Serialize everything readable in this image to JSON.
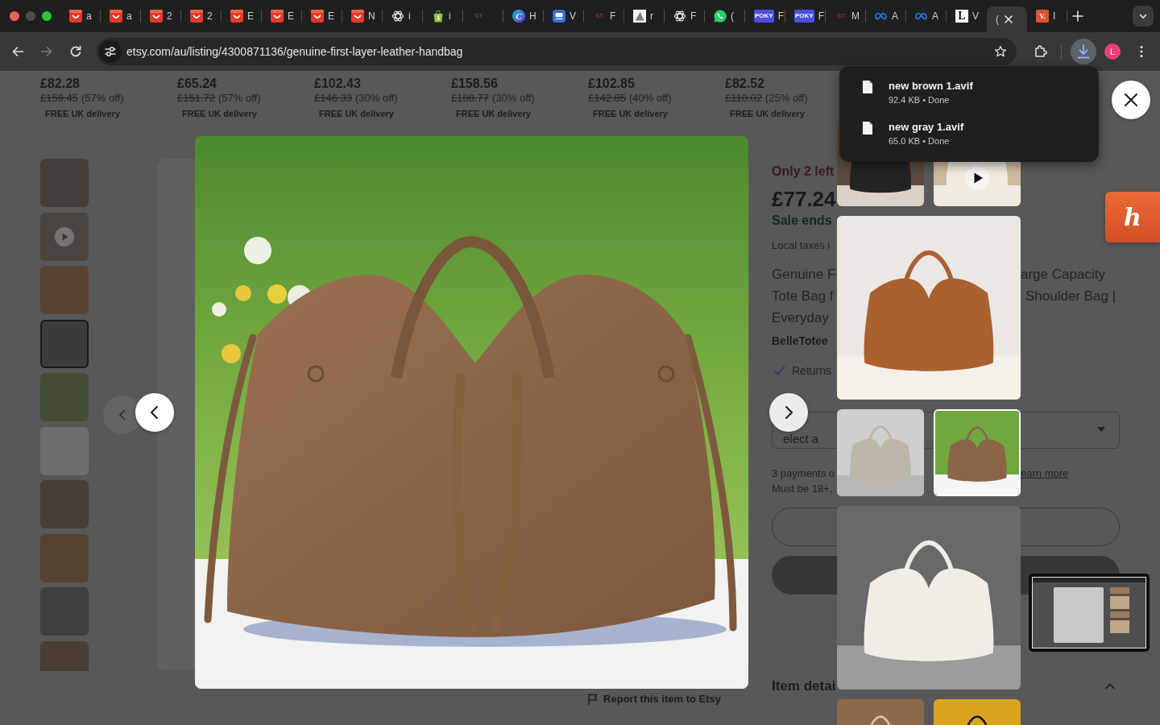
{
  "tabs": [
    {
      "kind": "smile",
      "title": "a",
      "selected": false
    },
    {
      "kind": "smile",
      "title": "a",
      "selected": false
    },
    {
      "kind": "smile",
      "title": "2",
      "selected": false
    },
    {
      "kind": "smile",
      "title": "2",
      "selected": false
    },
    {
      "kind": "smile",
      "title": "E",
      "selected": false
    },
    {
      "kind": "smile",
      "title": "E",
      "selected": false
    },
    {
      "kind": "smile",
      "title": "E",
      "selected": false
    },
    {
      "kind": "smile",
      "title": "N",
      "selected": false
    },
    {
      "kind": "knot",
      "title": "i",
      "selected": false
    },
    {
      "kind": "bag",
      "title": "i",
      "selected": false
    },
    {
      "kind": "wordmark",
      "logo": "ST",
      "selected": false
    },
    {
      "kind": "monogram",
      "logo": "C",
      "title": "H",
      "selected": false
    },
    {
      "kind": "app",
      "title": "V",
      "selected": false
    },
    {
      "kind": "wordmark",
      "logo": "ST",
      "title": "F",
      "selected": false
    },
    {
      "kind": "shark",
      "title": "r",
      "selected": false
    },
    {
      "kind": "knot",
      "title": "F",
      "selected": false
    },
    {
      "kind": "chat",
      "title": "(",
      "selected": false
    },
    {
      "kind": "badge",
      "logo": "POKY",
      "color": "#4b4ee3",
      "title": "F",
      "selected": false
    },
    {
      "kind": "badge",
      "logo": "POKY",
      "color": "#4b4ee3",
      "title": "F",
      "selected": false
    },
    {
      "kind": "wordmark",
      "logo": "ST",
      "title": "M",
      "selected": false
    },
    {
      "kind": "infinity",
      "title": "A",
      "selected": false
    },
    {
      "kind": "infinity",
      "title": "A",
      "selected": false
    },
    {
      "kind": "tile",
      "logo": "L",
      "title": "V",
      "selected": false
    },
    {
      "title": "(",
      "selected": true
    },
    {
      "kind": "badge",
      "logo": "V.",
      "color": "#e2502e",
      "title": "I",
      "selected": false
    }
  ],
  "toolbar": {
    "back_disabled": false,
    "forward_disabled": true,
    "url": "etsy.com/au/listing/4300871136/genuine-first-layer-leather-handbag",
    "downloads_active": true,
    "profile_initial": "L"
  },
  "page": {
    "price_cards": [
      {
        "price": "£82.28",
        "original_price": "£159.45",
        "discount": "(57% off)",
        "delivery": "FREE UK delivery"
      },
      {
        "price": "£65.24",
        "original_price": "£151.72",
        "discount": "(57% off)",
        "delivery": "FREE UK delivery"
      },
      {
        "price": "£102.43",
        "original_price": "£146.33",
        "discount": "(30% off)",
        "delivery": "FREE UK delivery"
      },
      {
        "price": "£158.56",
        "original_price": "£188.77",
        "discount": "(30% off)",
        "delivery": "FREE UK delivery"
      },
      {
        "price": "£102.85",
        "original_price": "£142.85",
        "discount": "(40% off)",
        "delivery": "FREE UK delivery"
      },
      {
        "price": "£82.52",
        "original_price": "£110.02",
        "discount": "(25% off)",
        "delivery": "FREE UK delivery"
      }
    ],
    "gallery": [
      {
        "video": false,
        "selected": false
      },
      {
        "video": true,
        "selected": false
      },
      {
        "video": false,
        "selected": false
      },
      {
        "video": false,
        "selected": true
      },
      {
        "video": false,
        "selected": false
      },
      {
        "video": false,
        "selected": false
      },
      {
        "video": false,
        "selected": false
      },
      {
        "video": false,
        "selected": false
      },
      {
        "video": false,
        "selected": false
      },
      {
        "video": false,
        "selected": false
      }
    ],
    "listing": {
      "stock": "Only 2 left",
      "price": "£77.24",
      "sale": "Sale ends",
      "taxes": "Local taxes i",
      "title_lines": [
        {
          "start": "Genuine F",
          "end": "arge Capacity"
        },
        {
          "start": "Tote Bag f",
          "end": "Shoulder Bag |"
        },
        {
          "start": "Everyday"
        }
      ],
      "shop": "BelleTotee",
      "returns": "Returns",
      "variation": {
        "placeholder": "elect a"
      },
      "payments": "3 payments o",
      "learn_more": "earn more",
      "age_note": "Must be 18+,",
      "item_details": "Item detai",
      "item_details_expanded": true
    },
    "report": "Report this item to Etsy"
  },
  "lightbox": {
    "rows": [
      {
        "kind": "pair",
        "items": [
          {
            "video": false,
            "selected": false
          },
          {
            "video": true,
            "selected": false
          }
        ]
      },
      {
        "kind": "single",
        "items": [
          {
            "video": false,
            "selected": false
          }
        ]
      },
      {
        "kind": "pair",
        "items": [
          {
            "video": false,
            "selected": false
          },
          {
            "video": false,
            "selected": true
          }
        ]
      },
      {
        "kind": "single",
        "items": [
          {
            "video": false,
            "selected": false
          }
        ]
      },
      {
        "kind": "pair",
        "items": [
          {
            "selected": false
          },
          {
            "selected": false
          }
        ]
      }
    ]
  },
  "downloads": {
    "items": [
      {
        "name": "new brown 1.avif",
        "detail": "92.4 KB • Done"
      },
      {
        "name": "new gray 1.avif",
        "detail": "65.0 KB • Done"
      }
    ]
  },
  "extension_tab": {
    "logo": "h"
  }
}
